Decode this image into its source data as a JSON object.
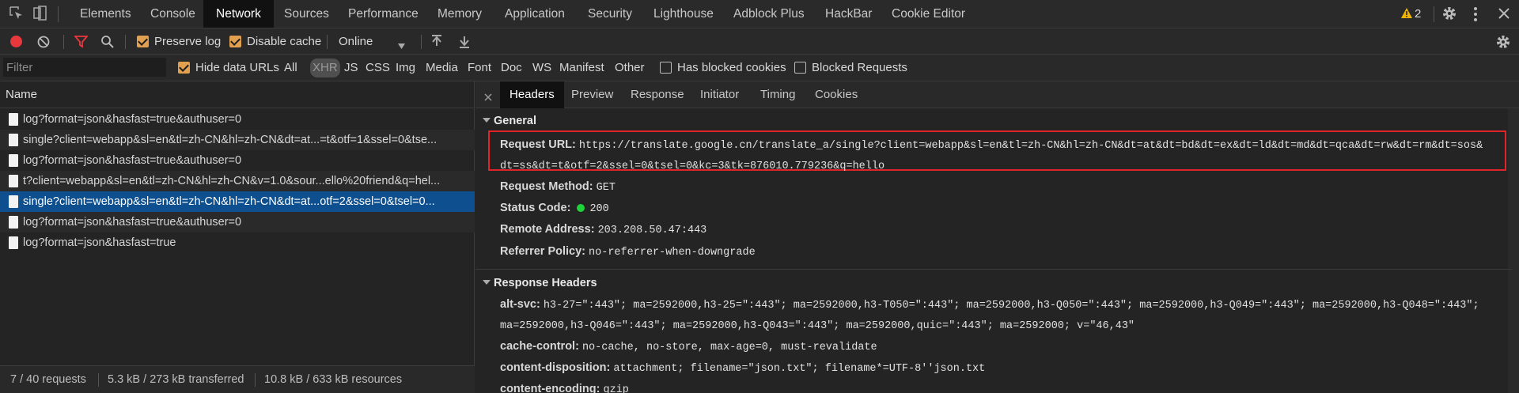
{
  "tabs": [
    "Elements",
    "Console",
    "Network",
    "Sources",
    "Performance",
    "Memory",
    "Application",
    "Security",
    "Lighthouse",
    "Adblock Plus",
    "HackBar",
    "Cookie Editor"
  ],
  "active_tab": "Network",
  "warnings_count": "2",
  "toolbar": {
    "preserve_log": "Preserve log",
    "disable_cache": "Disable cache",
    "throttle": "Online"
  },
  "filterbar": {
    "placeholder": "Filter",
    "hide_data_urls": "Hide data URLs",
    "types": [
      "All",
      "XHR",
      "JS",
      "CSS",
      "Img",
      "Media",
      "Font",
      "Doc",
      "WS",
      "Manifest",
      "Other"
    ],
    "selected_type": "XHR",
    "has_blocked_cookies": "Has blocked cookies",
    "blocked_requests": "Blocked Requests"
  },
  "list": {
    "header": "Name",
    "rows": [
      "log?format=json&hasfast=true&authuser=0",
      "single?client=webapp&sl=en&tl=zh-CN&hl=zh-CN&dt=at...=t&otf=1&ssel=0&tse...",
      "log?format=json&hasfast=true&authuser=0",
      "t?client=webapp&sl=en&tl=zh-CN&hl=zh-CN&v=1.0&sour...ello%20friend&q=hel...",
      "single?client=webapp&sl=en&tl=zh-CN&hl=zh-CN&dt=at...otf=2&ssel=0&tsel=0...",
      "log?format=json&hasfast=true&authuser=0",
      "log?format=json&hasfast=true"
    ],
    "selected_index": 4
  },
  "statusbar": {
    "requests": "7 / 40 requests",
    "transferred": "5.3 kB / 273 kB transferred",
    "resources": "10.8 kB / 633 kB resources"
  },
  "detail_tabs": [
    "Headers",
    "Preview",
    "Response",
    "Initiator",
    "Timing",
    "Cookies"
  ],
  "detail_active": "Headers",
  "general": {
    "title": "General",
    "request_url_label": "Request URL:",
    "request_url_line1": "https://translate.google.cn/translate_a/single?client=webapp&sl=en&tl=zh-CN&hl=zh-CN&dt=at&dt=bd&dt=ex&dt=ld&dt=md&dt=qca&dt=rw&dt=rm&dt=sos&",
    "request_url_line2": "dt=ss&dt=t&otf=2&ssel=0&tsel=0&kc=3&tk=876010.779236&q=hello",
    "request_method_label": "Request Method:",
    "request_method": "GET",
    "status_code_label": "Status Code:",
    "status_code": "200",
    "remote_address_label": "Remote Address:",
    "remote_address": "203.208.50.47:443",
    "referrer_policy_label": "Referrer Policy:",
    "referrer_policy": "no-referrer-when-downgrade"
  },
  "response_headers": {
    "title": "Response Headers",
    "alt_svc_label": "alt-svc:",
    "alt_svc_line1": "h3-27=\":443\"; ma=2592000,h3-25=\":443\"; ma=2592000,h3-T050=\":443\"; ma=2592000,h3-Q050=\":443\"; ma=2592000,h3-Q049=\":443\"; ma=2592000,h3-Q048=\":443\";",
    "alt_svc_line2": "ma=2592000,h3-Q046=\":443\"; ma=2592000,h3-Q043=\":443\"; ma=2592000,quic=\":443\"; ma=2592000; v=\"46,43\"",
    "cache_control_label": "cache-control:",
    "cache_control": "no-cache, no-store, max-age=0, must-revalidate",
    "content_disposition_label": "content-disposition:",
    "content_disposition": "attachment; filename=\"json.txt\"; filename*=UTF-8''json.txt",
    "content_encoding_label": "content-encoding:",
    "content_encoding": "gzip"
  },
  "colors": {
    "accent": "#e0a050",
    "selected_row": "#0d4f8f",
    "record": "#e8383d",
    "highlight_box": "#e0252a",
    "status_ok": "#1fd33a"
  }
}
